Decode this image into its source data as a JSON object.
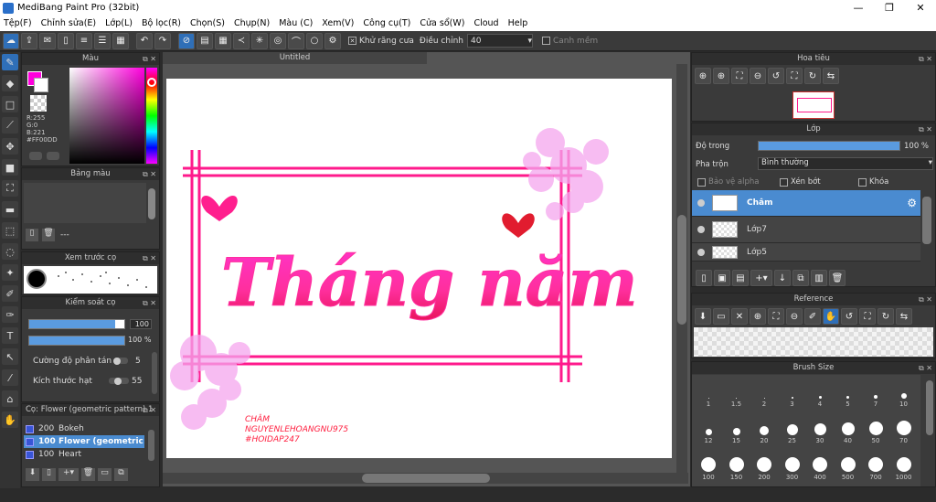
{
  "window": {
    "title": "MediBang Paint Pro (32bit)",
    "controls": [
      "—",
      "❐",
      "✕"
    ]
  },
  "menu": [
    "Tệp(F)",
    "Chỉnh sửa(E)",
    "Lớp(L)",
    "Bộ lọc(R)",
    "Chọn(S)",
    "Chụp(N)",
    "Màu (C)",
    "Xem(V)",
    "Công cụ(T)",
    "Cửa sổ(W)",
    "Cloud",
    "Help"
  ],
  "toolbar": {
    "antialias_label": "Khử răng cưa",
    "adjust_label": "Điều chỉnh",
    "adjust_value": "40",
    "snap_label": "Canh mềm"
  },
  "color_panel": {
    "title": "Màu",
    "primary_color": "#FF00DD",
    "r": "R:255",
    "g": "G:0",
    "b": "B:221",
    "hex": "#FF00DD"
  },
  "palette_panel": {
    "title": "Bảng màu",
    "placeholder": "---"
  },
  "brush_preview_panel": {
    "title": "Xem trước cọ"
  },
  "brush_control_panel": {
    "title": "Kiểm soát cọ",
    "size_value": "100",
    "opacity_value": "100 %",
    "scatter_label": "Cường độ phân tán",
    "scatter_value": "5",
    "particle_label": "Kích thước hạt",
    "particle_value": "55"
  },
  "brush_list_panel": {
    "title": "Cọ: Flower (geometric pattern) 1",
    "items": [
      {
        "size": "200",
        "name": "Bokeh"
      },
      {
        "size": "100",
        "name": "Flower (geometric"
      },
      {
        "size": "100",
        "name": "Heart"
      }
    ]
  },
  "canvas": {
    "tab_title": "Untitled",
    "artwork_text": "Tháng năm",
    "signature": [
      "CHÂM",
      "NGUYENLEHOANGNU975",
      "#HOIDAP247"
    ]
  },
  "navigator_panel": {
    "title": "Hoa tiêu"
  },
  "layer_panel": {
    "title": "Lớp",
    "opacity_label": "Độ trong",
    "opacity_value": "100 %",
    "opacity_fraction": 1.0,
    "blend_label": "Pha trộn",
    "blend_value": "Bình thường",
    "protect_alpha": "Bảo vệ alpha",
    "clipping": "Xén bớt",
    "lock": "Khóa",
    "layers": [
      "Châm",
      "Lớp7",
      "Lớp5"
    ]
  },
  "reference_panel": {
    "title": "Reference"
  },
  "brush_size_panel": {
    "title": "Brush Size",
    "sizes": [
      "1",
      "1.5",
      "2",
      "3",
      "4",
      "5",
      "7",
      "10",
      "12",
      "15",
      "20",
      "25",
      "30",
      "40",
      "50",
      "70",
      "100",
      "150",
      "200",
      "300",
      "400",
      "500",
      "700",
      "1000"
    ]
  },
  "colors": {
    "accent": "#4a8bd0",
    "pink": "#ff00dd",
    "frame": "#e8145a"
  }
}
